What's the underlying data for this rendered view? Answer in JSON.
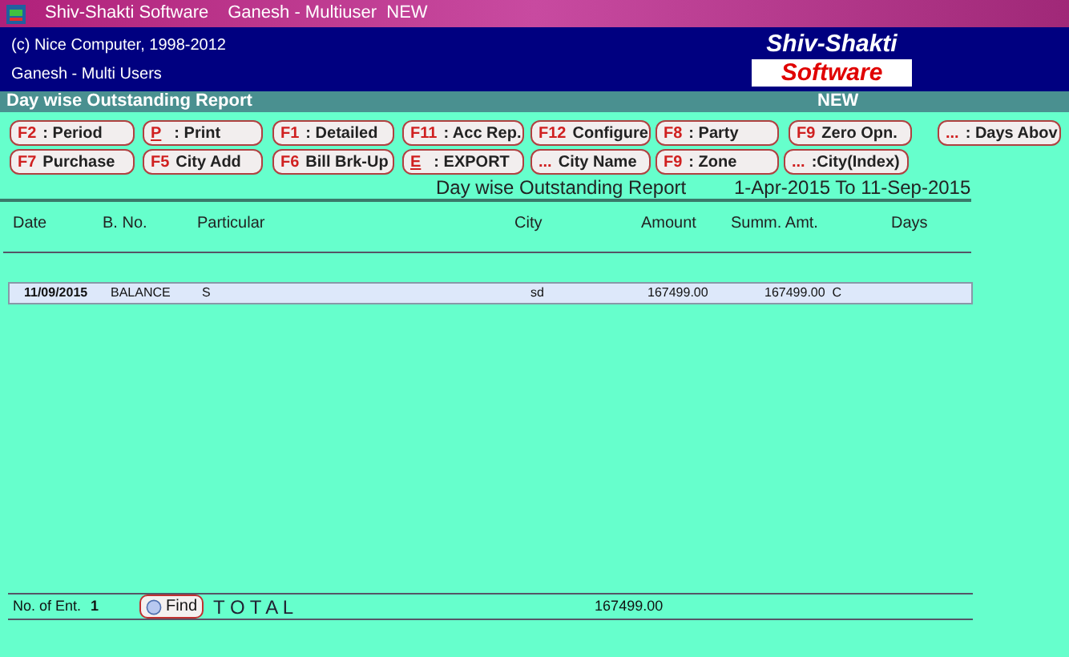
{
  "window": {
    "title": "Shiv-Shakti Software",
    "subtitle": "Ganesh - Multiuser  NEW"
  },
  "header": {
    "copyright": "(c) Nice Computer, 1998-2012",
    "users": "Ganesh - Multi Users",
    "logo_top": "Shiv-Shakti",
    "logo_bottom": "Software"
  },
  "report_bar": {
    "title": "Day wise Outstanding Report",
    "status": "NEW"
  },
  "toolbar": [
    [
      {
        "key": "F2",
        "label": ": Period",
        "key_underlined": false
      },
      {
        "key": "P",
        "label": ": Print",
        "key_underlined": true
      },
      {
        "key": "F1",
        "label": ": Detailed",
        "key_underlined": false
      },
      {
        "key": "F11",
        "label": ": Acc Rep.",
        "key_underlined": false
      },
      {
        "key": "F12",
        "label": "Configure",
        "key_underlined": false
      },
      {
        "key": "F8",
        "label": ": Party",
        "key_underlined": false
      },
      {
        "key": "F9",
        "label": "Zero Opn.",
        "key_underlined": false
      },
      {
        "key": "...",
        "label": ": Days Abov",
        "key_underlined": false
      }
    ],
    [
      {
        "key": "F7",
        "label": "Purchase",
        "key_underlined": false
      },
      {
        "key": "F5",
        "label": "City Add",
        "key_underlined": false
      },
      {
        "key": "F6",
        "label": "Bill Brk-Up",
        "key_underlined": false
      },
      {
        "key": "E",
        "label": ": EXPORT",
        "key_underlined": true
      },
      {
        "key": "...",
        "label": "City Name",
        "key_underlined": false
      },
      {
        "key": "F9",
        "label": ": Zone",
        "key_underlined": false
      },
      {
        "key": "...",
        "label": ":City(Index)",
        "key_underlined": false
      }
    ]
  ],
  "report": {
    "title": "Day wise Outstanding Report",
    "period": "1-Apr-2015 To 11-Sep-2015"
  },
  "table": {
    "columns": [
      "Date",
      "B. No.",
      "Particular",
      "City",
      "Amount",
      "Summ. Amt.",
      "Days"
    ],
    "rows": [
      {
        "selected": true,
        "cells": [
          "11/09/2015",
          "BALANCE",
          "S",
          "sd",
          "167499.00",
          "167499.00  C",
          ""
        ]
      }
    ]
  },
  "footer": {
    "entries_label": "No. of Ent.",
    "entries": "1",
    "find": "Find",
    "total_label": "T O T A L",
    "total": "167499.00"
  }
}
